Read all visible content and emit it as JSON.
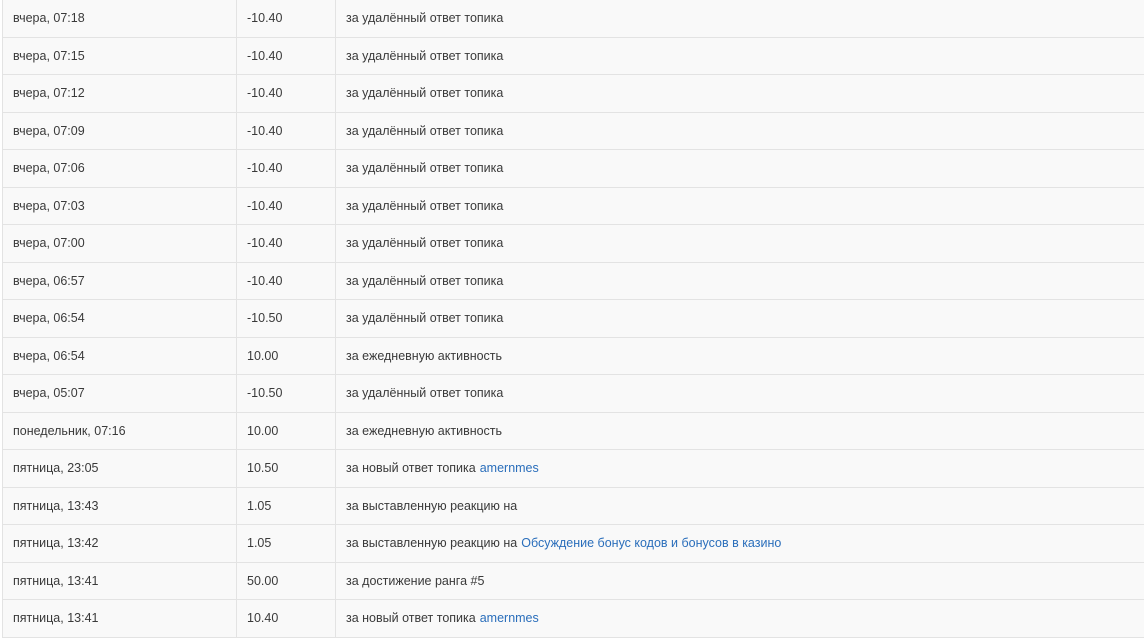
{
  "rows": [
    {
      "date": "вчера, 07:18",
      "amount": "-10.40",
      "reason": "за удалённый ответ топика",
      "link": ""
    },
    {
      "date": "вчера, 07:15",
      "amount": "-10.40",
      "reason": "за удалённый ответ топика",
      "link": ""
    },
    {
      "date": "вчера, 07:12",
      "amount": "-10.40",
      "reason": "за удалённый ответ топика",
      "link": ""
    },
    {
      "date": "вчера, 07:09",
      "amount": "-10.40",
      "reason": "за удалённый ответ топика",
      "link": ""
    },
    {
      "date": "вчера, 07:06",
      "amount": "-10.40",
      "reason": "за удалённый ответ топика",
      "link": ""
    },
    {
      "date": "вчера, 07:03",
      "amount": "-10.40",
      "reason": "за удалённый ответ топика",
      "link": ""
    },
    {
      "date": "вчера, 07:00",
      "amount": "-10.40",
      "reason": "за удалённый ответ топика",
      "link": ""
    },
    {
      "date": "вчера, 06:57",
      "amount": "-10.40",
      "reason": "за удалённый ответ топика",
      "link": ""
    },
    {
      "date": "вчера, 06:54",
      "amount": "-10.50",
      "reason": "за удалённый ответ топика",
      "link": ""
    },
    {
      "date": "вчера, 06:54",
      "amount": "10.00",
      "reason": "за ежедневную активность",
      "link": ""
    },
    {
      "date": "вчера, 05:07",
      "amount": "-10.50",
      "reason": "за удалённый ответ топика",
      "link": ""
    },
    {
      "date": "понедельник, 07:16",
      "amount": "10.00",
      "reason": "за ежедневную активность",
      "link": ""
    },
    {
      "date": "пятница, 23:05",
      "amount": "10.50",
      "reason": "за новый ответ топика",
      "link": "amernmes"
    },
    {
      "date": "пятница, 13:43",
      "amount": "1.05",
      "reason": "за выставленную реакцию на",
      "link": ""
    },
    {
      "date": "пятница, 13:42",
      "amount": "1.05",
      "reason": "за выставленную реакцию на",
      "link": "Обсуждение бонус кодов и бонусов в казино"
    },
    {
      "date": "пятница, 13:41",
      "amount": "50.00",
      "reason": "за достижение ранга #5",
      "link": ""
    },
    {
      "date": "пятница, 13:41",
      "amount": "10.40",
      "reason": "за новый ответ топика",
      "link": "amernmes"
    }
  ]
}
